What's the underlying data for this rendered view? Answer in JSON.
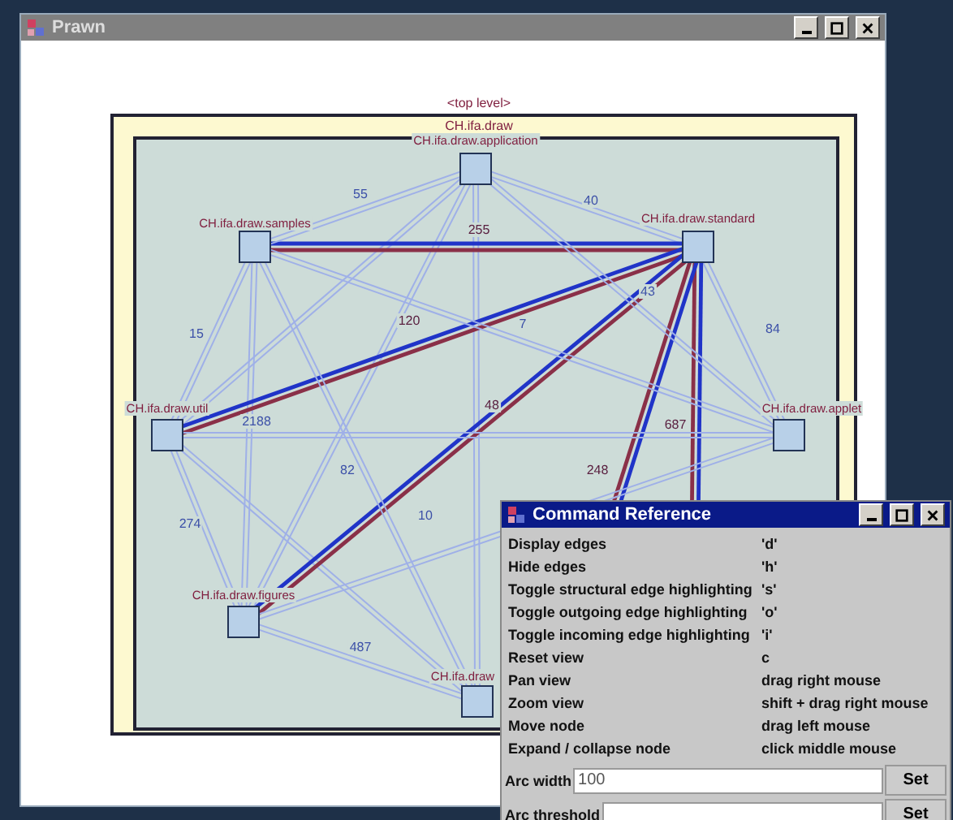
{
  "window": {
    "title": "Prawn"
  },
  "canvas": {
    "top_label": "<top level>",
    "package_label": "CH.ifa.draw",
    "nodes": [
      {
        "label": "CH.ifa.draw.application"
      },
      {
        "label": "CH.ifa.draw.samples"
      },
      {
        "label": "CH.ifa.draw.standard"
      },
      {
        "label": "CH.ifa.draw.util"
      },
      {
        "label": "CH.ifa.draw.applet"
      },
      {
        "label": "CH.ifa.draw.figures"
      },
      {
        "label": "CH.ifa.draw"
      }
    ],
    "edges": [
      {
        "highlighted": false,
        "label": "40"
      },
      {
        "highlighted": true,
        "label": "255"
      },
      {
        "highlighted": true,
        "label": "120"
      },
      {
        "highlighted": true,
        "label": "48"
      },
      {
        "highlighted": false,
        "label": "84"
      },
      {
        "highlighted": true,
        "label": "687"
      },
      {
        "highlighted": true,
        "label": "248"
      },
      {
        "highlighted": false,
        "label": "55"
      },
      {
        "highlighted": false,
        "label": "15"
      },
      {
        "highlighted": false,
        "label": "7"
      },
      {
        "highlighted": false,
        "label": "82"
      },
      {
        "highlighted": false,
        "label": "2188"
      },
      {
        "highlighted": false,
        "label": "274"
      },
      {
        "highlighted": false,
        "label": "487"
      },
      {
        "highlighted": false,
        "label": "10"
      },
      {
        "highlighted": false,
        "label": "43"
      }
    ]
  },
  "dialog": {
    "title": "Command Reference",
    "commands": [
      {
        "action": "Display edges",
        "key": "'d'"
      },
      {
        "action": "Hide edges",
        "key": "'h'"
      },
      {
        "action": "Toggle structural edge highlighting",
        "key": "'s'"
      },
      {
        "action": "Toggle outgoing edge highlighting",
        "key": "'o'"
      },
      {
        "action": "Toggle incoming edge highlighting",
        "key": "'i'"
      },
      {
        "action": "Reset view",
        "key": "c"
      },
      {
        "action": "Pan view",
        "key": "drag right mouse"
      },
      {
        "action": "Zoom view",
        "key": "shift + drag right mouse"
      },
      {
        "action": "Move node",
        "key": "drag left mouse"
      },
      {
        "action": "Expand / collapse node",
        "key": "click middle mouse"
      }
    ],
    "settings": [
      {
        "label": "Arc width",
        "value": "100",
        "button": "Set"
      },
      {
        "label": "Arc threshold",
        "button": "Set"
      }
    ]
  }
}
